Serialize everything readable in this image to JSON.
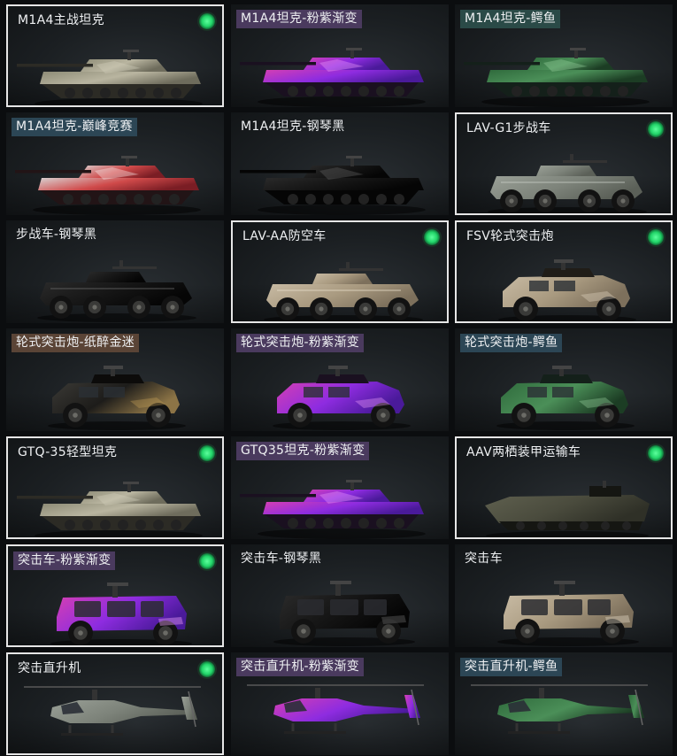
{
  "cards": [
    {
      "title": "M1A4主战坦克",
      "tag": "none",
      "selected": true,
      "equipped": true,
      "vehicle": "tank",
      "skin": "desert-camo"
    },
    {
      "title": "M1A4坦克-粉紫渐变",
      "tag": "purple",
      "selected": false,
      "equipped": false,
      "vehicle": "tank",
      "skin": "pink-purple-gradient"
    },
    {
      "title": "M1A4坦克-鳄鱼",
      "tag": "teal",
      "selected": false,
      "equipped": false,
      "vehicle": "tank",
      "skin": "crocodile"
    },
    {
      "title": "M1A4坦克-巅峰竞赛",
      "tag": "blue",
      "selected": false,
      "equipped": false,
      "vehicle": "tank",
      "skin": "peak-race"
    },
    {
      "title": "M1A4坦克-钢琴黑",
      "tag": "none",
      "selected": false,
      "equipped": false,
      "vehicle": "tank",
      "skin": "piano-black"
    },
    {
      "title": "LAV-G1步战车",
      "tag": "none",
      "selected": true,
      "equipped": true,
      "vehicle": "apc",
      "skin": "grey"
    },
    {
      "title": "步战车-钢琴黑",
      "tag": "none",
      "selected": false,
      "equipped": false,
      "vehicle": "apc",
      "skin": "piano-black"
    },
    {
      "title": "LAV-AA防空车",
      "tag": "none",
      "selected": true,
      "equipped": true,
      "vehicle": "apc",
      "skin": "sand"
    },
    {
      "title": "FSV轮式突击炮",
      "tag": "none",
      "selected": true,
      "equipped": true,
      "vehicle": "wheeled",
      "skin": "sand"
    },
    {
      "title": "轮式突击炮-纸醉金迷",
      "tag": "brown",
      "selected": false,
      "equipped": false,
      "vehicle": "wheeled",
      "skin": "gold-black"
    },
    {
      "title": "轮式突击炮-粉紫渐变",
      "tag": "purple",
      "selected": false,
      "equipped": false,
      "vehicle": "wheeled",
      "skin": "pink-purple-gradient"
    },
    {
      "title": "轮式突击炮-鳄鱼",
      "tag": "blue",
      "selected": false,
      "equipped": false,
      "vehicle": "wheeled",
      "skin": "crocodile"
    },
    {
      "title": "GTQ-35轻型坦克",
      "tag": "none",
      "selected": true,
      "equipped": true,
      "vehicle": "tank",
      "skin": "desert-camo"
    },
    {
      "title": "GTQ35坦克-粉紫渐变",
      "tag": "purple",
      "selected": false,
      "equipped": false,
      "vehicle": "tank",
      "skin": "pink-purple-gradient"
    },
    {
      "title": "AAV两栖装甲运输车",
      "tag": "none",
      "selected": true,
      "equipped": true,
      "vehicle": "amphib",
      "skin": "olive"
    },
    {
      "title": "突击车-粉紫渐变",
      "tag": "purple",
      "selected": true,
      "equipped": true,
      "vehicle": "assault",
      "skin": "pink-purple-gradient"
    },
    {
      "title": "突击车-钢琴黑",
      "tag": "none",
      "selected": false,
      "equipped": false,
      "vehicle": "assault",
      "skin": "piano-black"
    },
    {
      "title": "突击车",
      "tag": "none",
      "selected": false,
      "equipped": false,
      "vehicle": "assault",
      "skin": "sand"
    },
    {
      "title": "突击直升机",
      "tag": "none",
      "selected": true,
      "equipped": true,
      "vehicle": "heli",
      "skin": "grey"
    },
    {
      "title": "突击直升机-粉紫渐变",
      "tag": "purple",
      "selected": false,
      "equipped": false,
      "vehicle": "heli",
      "skin": "pink-purple-gradient"
    },
    {
      "title": "突击直升机-鳄鱼",
      "tag": "blue",
      "selected": false,
      "equipped": false,
      "vehicle": "heli",
      "skin": "crocodile"
    }
  ],
  "colors": {
    "equipped_indicator": "#21d468",
    "selected_border": "#e6e6e6"
  }
}
